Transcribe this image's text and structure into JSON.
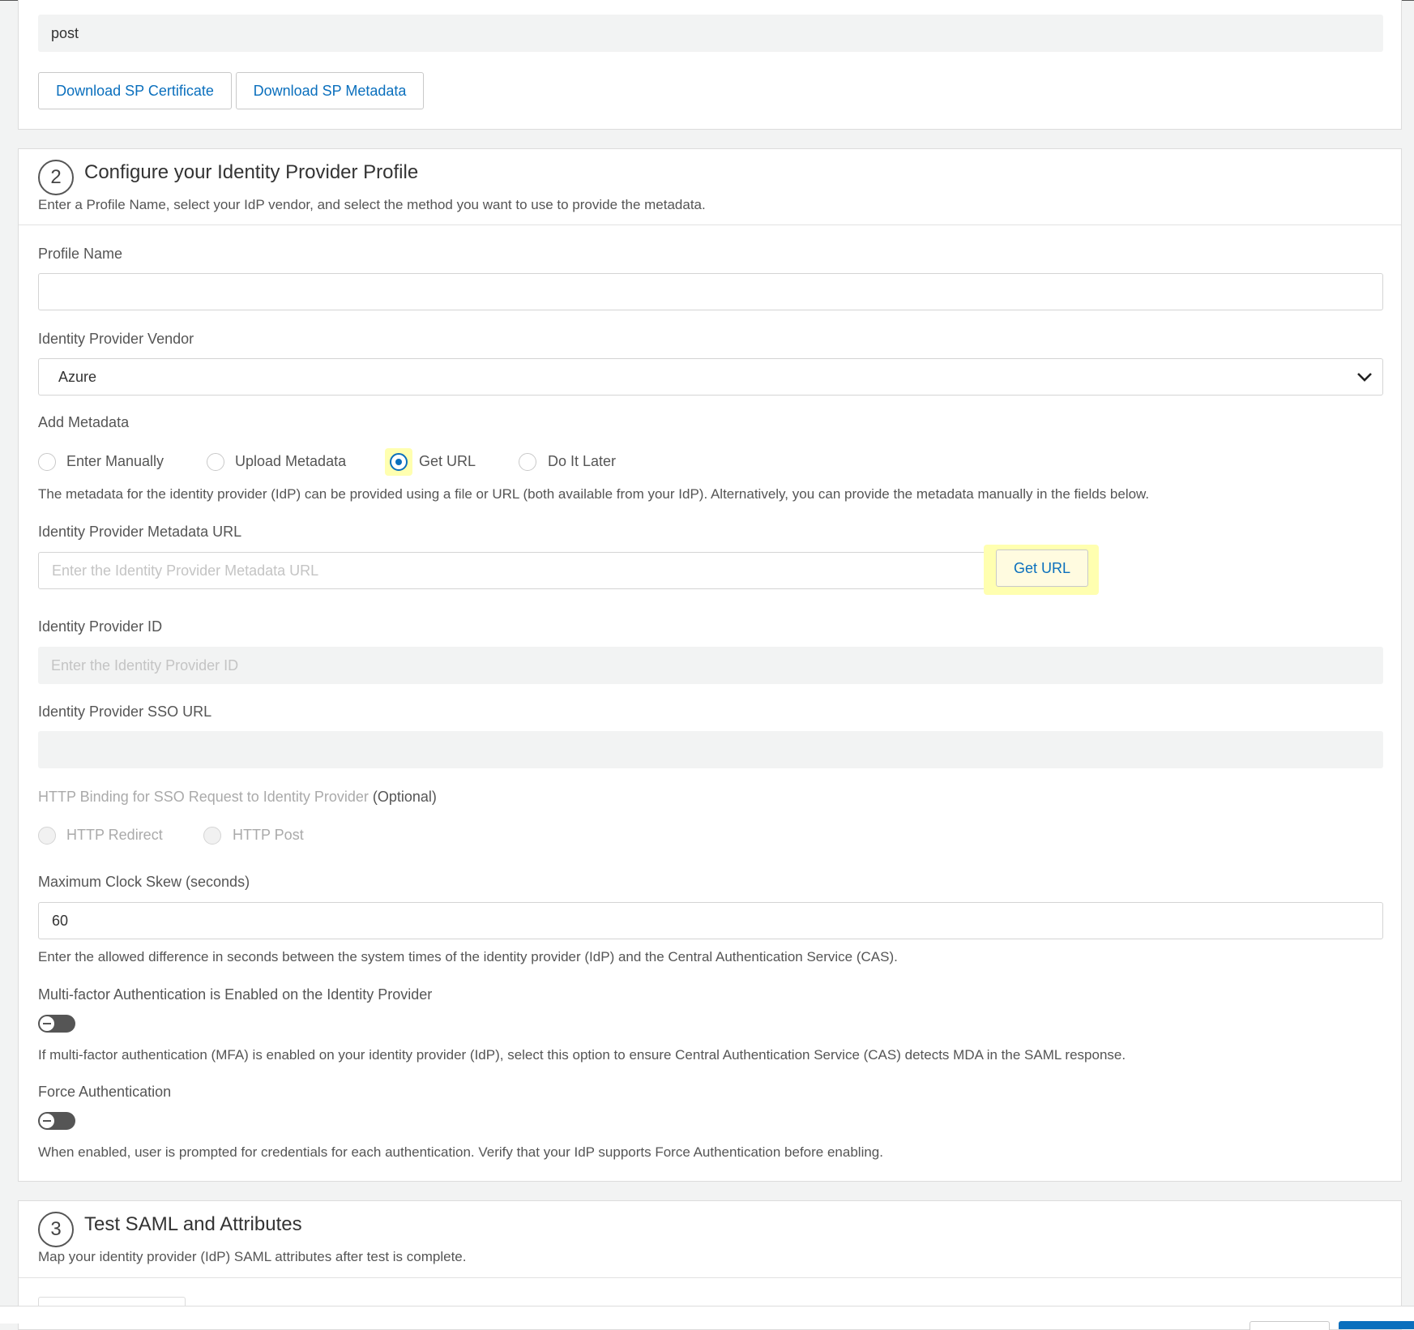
{
  "card1": {
    "binding_value": "post",
    "download_cert_label": "Download SP Certificate",
    "download_metadata_label": "Download SP Metadata"
  },
  "card2": {
    "step_number": "2",
    "title": "Configure your Identity Provider Profile",
    "description": "Enter a Profile Name, select your IdP vendor, and select the method you want to use to provide the metadata.",
    "profile_name": {
      "label": "Profile Name",
      "value": ""
    },
    "vendor": {
      "label": "Identity Provider Vendor",
      "value": "Azure"
    },
    "add_metadata": {
      "label": "Add Metadata",
      "options": [
        "Enter Manually",
        "Upload Metadata",
        "Get URL",
        "Do It Later"
      ],
      "selected": "Get URL",
      "help": "The metadata for the identity provider (IdP) can be provided using a file or URL (both available from your IdP). Alternatively, you can provide the metadata manually in the fields below."
    },
    "metadata_url": {
      "label": "Identity Provider Metadata URL",
      "placeholder": "Enter the Identity Provider Metadata URL",
      "button_label": "Get URL"
    },
    "idp_id": {
      "label": "Identity Provider ID",
      "placeholder": "Enter the Identity Provider ID"
    },
    "sso_url": {
      "label": "Identity Provider SSO URL",
      "value": ""
    },
    "http_binding": {
      "label": "HTTP Binding for SSO Request to Identity Provider",
      "optional": "(Optional)",
      "options": [
        "HTTP Redirect",
        "HTTP Post"
      ]
    },
    "clock_skew": {
      "label": "Maximum Clock Skew (seconds)",
      "value": "60",
      "help": "Enter the allowed difference in seconds between the system times of the identity provider (IdP) and the Central Authentication Service (CAS)."
    },
    "mfa": {
      "label": "Multi-factor Authentication is Enabled on the Identity Provider",
      "help": "If multi-factor authentication (MFA) is enabled on your identity provider (IdP), select this option to ensure Central Authentication Service (CAS) detects MDA in the SAML response."
    },
    "force_auth": {
      "label": "Force Authentication",
      "help": "When enabled, user is prompted for credentials for each authentication. Verify that your IdP supports Force Authentication before enabling."
    }
  },
  "card3": {
    "step_number": "3",
    "title": "Test SAML and Attributes",
    "description": "Map your identity provider (IdP) SAML attributes after test is complete."
  },
  "colors": {
    "accent": "#0a6fbd",
    "highlight": "#ffffb0",
    "toggle_off": "#555555"
  }
}
